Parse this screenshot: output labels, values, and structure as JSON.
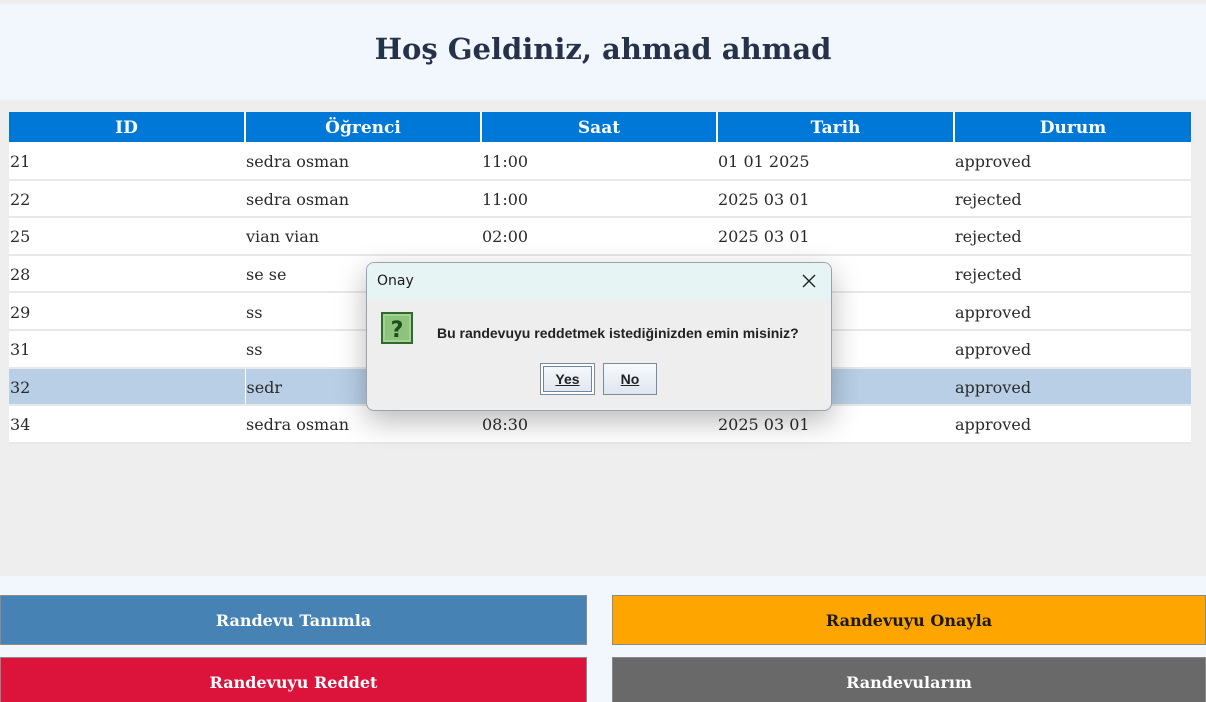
{
  "header": {
    "welcome": "Hoş Geldiniz, ahmad ahmad"
  },
  "table": {
    "columns": [
      "ID",
      "Öğrenci",
      "Saat",
      "Tarih",
      "Durum"
    ],
    "rows": [
      [
        "21",
        "sedra osman",
        "11:00",
        "01 01 2025",
        "approved"
      ],
      [
        "22",
        "sedra osman",
        "11:00",
        "2025 03 01",
        "rejected"
      ],
      [
        "25",
        "vian vian",
        "02:00",
        "2025 03 01",
        "rejected"
      ],
      [
        "28",
        "se se",
        "",
        "",
        "rejected"
      ],
      [
        "29",
        "ss",
        "",
        "",
        "approved"
      ],
      [
        "31",
        "ss",
        "",
        "",
        "approved"
      ],
      [
        "32",
        "sedr",
        "",
        "",
        "approved"
      ],
      [
        "34",
        "sedra osman",
        "08:30",
        "2025 03 01",
        "approved"
      ]
    ],
    "selected_row_index": 6
  },
  "buttons": {
    "define": "Randevu Tanımla",
    "approve": "Randevuyu Onayla",
    "reject": "Randevuyu Reddet",
    "mine": "Randevularım"
  },
  "dialog": {
    "title": "Onay",
    "message": "Bu randevuyu reddetmek istediğinizden emin misiniz?",
    "yes": "Yes",
    "no": "No",
    "icon": "question-icon",
    "close_icon": "close-icon"
  },
  "colors": {
    "header_bg": "#f2f6fd",
    "table_header": "#0078d7",
    "selected_row": "#b8cfe6",
    "define_btn": "#4682b4",
    "approve_btn": "#ffa500",
    "reject_btn": "#dc143c",
    "mine_btn": "#696969"
  }
}
